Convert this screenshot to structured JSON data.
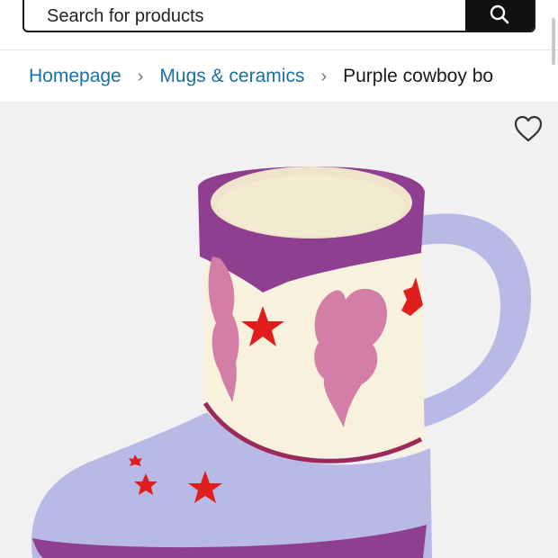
{
  "search": {
    "placeholder": "Search for products",
    "button_icon": "search-icon"
  },
  "breadcrumb": {
    "items": [
      {
        "label": "Homepage"
      },
      {
        "label": "Mugs & ceramics"
      }
    ],
    "current": "Purple cowboy bo"
  },
  "product": {
    "favorite_icon": "heart-icon",
    "image": "purple cowboy boot mug",
    "colors": {
      "purple": "#8e3f8f",
      "lavender": "#b9b9e6",
      "cream": "#f7f1de",
      "pink": "#d27ea6",
      "star_red": "#e01e1e"
    }
  },
  "colors": {
    "link": "#1a6fa6",
    "search_button": "#111111",
    "image_bg": "#f1f1f1"
  }
}
